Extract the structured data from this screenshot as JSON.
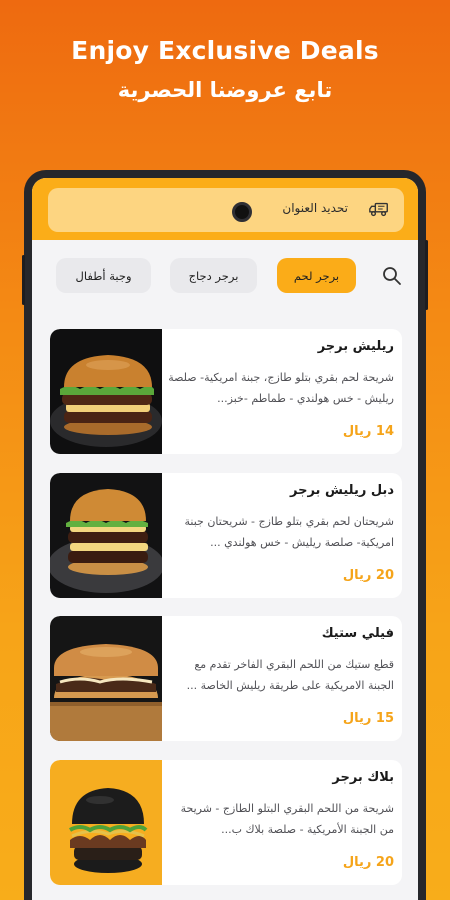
{
  "hero": {
    "title_en": "Enjoy Exclusive Deals",
    "title_ar": "تابع عروضنا الحصرية"
  },
  "header": {
    "address_label": "تحديد العنوان",
    "icon": "delivery-truck-icon"
  },
  "filters": {
    "search_icon": "search-icon",
    "chips": [
      {
        "label": "برجر لحم",
        "active": true
      },
      {
        "label": "برجر دجاج",
        "active": false
      },
      {
        "label": "وجبة أطفال",
        "active": false
      }
    ]
  },
  "products": [
    {
      "name": "ريليش برجر",
      "description": "شريحة لحم بقري بتلو طازج، جبنة امريكية- صلصة ريليش - خس هولندي - طماطم -خبز...",
      "price": "14 ريال"
    },
    {
      "name": "دبل ريليش برجر",
      "description": "شريحتان لحم بقري بتلو طازج - شريحتان جبنة امريكية- صلصة ريليش - خس هولندي ...",
      "price": "20 ريال"
    },
    {
      "name": "فيلي ستيك",
      "description": "قطع ستيك من اللحم البقري الفاخر تقدم مع الجبنة الامريكية على طريقة ريليش الخاصة ...",
      "price": "15 ريال"
    },
    {
      "name": "بلاك برجر",
      "description": "شريحة من اللحم البقري البتلو الطازج - شريحة من الجبنة الأمريكية - صلصة بلاك ب...",
      "price": "20 ريال"
    }
  ],
  "colors": {
    "accent": "#fbac18",
    "price": "#f5a41a",
    "background_top": "#ee6a10",
    "background_bottom": "#f8ad1a"
  }
}
